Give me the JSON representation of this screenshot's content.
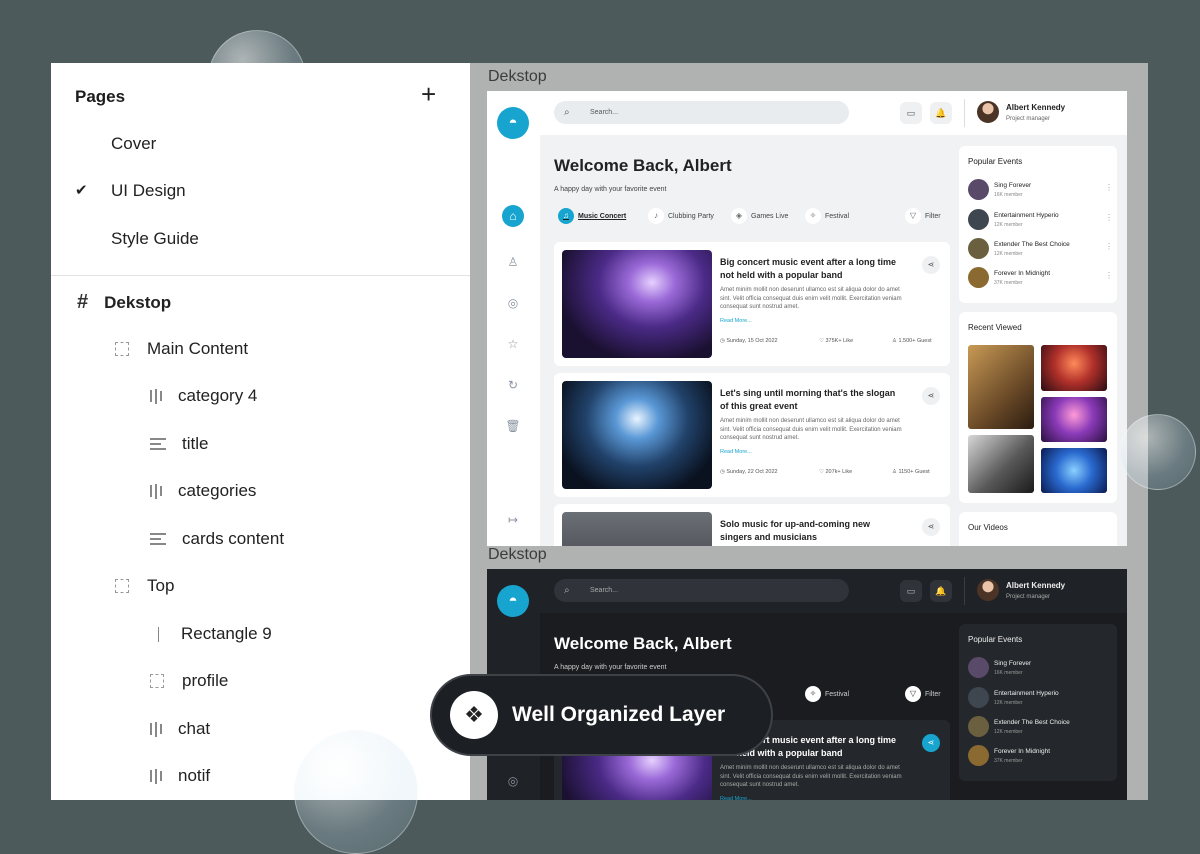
{
  "layers_panel": {
    "title": "Pages",
    "pages": [
      {
        "label": "Cover",
        "selected": false
      },
      {
        "label": "UI Design",
        "selected": true
      },
      {
        "label": "Style Guide",
        "selected": false
      }
    ],
    "layers": [
      {
        "label": "Dekstop",
        "icon": "hash-icon"
      },
      {
        "label": "Main Content",
        "icon": "frame-icon"
      },
      {
        "label": "category 4",
        "icon": "columns-icon"
      },
      {
        "label": "title",
        "icon": "text-icon"
      },
      {
        "label": "categories",
        "icon": "columns-icon"
      },
      {
        "label": "cards content",
        "icon": "text-icon"
      },
      {
        "label": "Top",
        "icon": "frame-icon"
      },
      {
        "label": "Rectangle 9",
        "icon": "line-icon"
      },
      {
        "label": "profile",
        "icon": "frame-icon"
      },
      {
        "label": "chat",
        "icon": "columns-icon"
      },
      {
        "label": "notif",
        "icon": "columns-icon"
      }
    ]
  },
  "frames": [
    {
      "label": "Dekstop",
      "theme": "light"
    },
    {
      "label": "Dekstop",
      "theme": "dark"
    }
  ],
  "app": {
    "search_placeholder": "Search...",
    "user_name": "Albert Kennedy",
    "user_role": "Project manager",
    "welcome": "Welcome Back, Albert",
    "tagline": "A happy day with your favorite event",
    "categories": [
      {
        "label": "Music Concert",
        "icon": "music-icon",
        "selected": true
      },
      {
        "label": "Clubbing Party",
        "icon": "guitar-icon",
        "selected": false
      },
      {
        "label": "Games Live",
        "icon": "gamepad-icon",
        "selected": false
      },
      {
        "label": "Festival",
        "icon": "party-icon",
        "selected": false
      }
    ],
    "filter_label": "Filter",
    "cards": [
      {
        "title": "Big concert music event after a long time not held with a popular band",
        "desc": "Amet minim mollit non deserunt ullamco est sit aliqua dolor do amet sint. Velit officia consequat duis enim velit mollit. Exercitation veniam consequat sunt nostrud amet.",
        "more": "Read More...",
        "date": "Sunday, 15 Oct 2022",
        "likes": "375K+ Like",
        "guests": "1.500+ Guest"
      },
      {
        "title": "Let's sing until morning that's the slogan of this great event",
        "desc": "Amet minim mollit non deserunt ullamco est sit aliqua dolor do amet sint. Velit officia consequat duis enim velit mollit. Exercitation veniam consequat sunt nostrud amet.",
        "more": "Read More...",
        "date": "Sunday, 22 Oct 2022",
        "likes": "207k+ Like",
        "guests": "1150+ Guest"
      },
      {
        "title": "Solo music for up-and-coming new singers and musicians"
      }
    ],
    "popular_events": {
      "title": "Popular Events",
      "items": [
        {
          "name": "Sing Forever",
          "members": "16K member",
          "color": "#5a4a6a"
        },
        {
          "name": "Entertainment Hyperio",
          "members": "12K member",
          "color": "#3e4650"
        },
        {
          "name": "Extender The Best Choice",
          "members": "12K member",
          "color": "#6a6040"
        },
        {
          "name": "Forever In Midnight",
          "members": "37K member",
          "color": "#8a6a30"
        }
      ]
    },
    "recent_viewed": {
      "title": "Recent Viewed"
    },
    "our_videos": {
      "title": "Our Videos"
    }
  },
  "badge": {
    "label": "Well Organized Layer",
    "icon": "layers-icon"
  }
}
